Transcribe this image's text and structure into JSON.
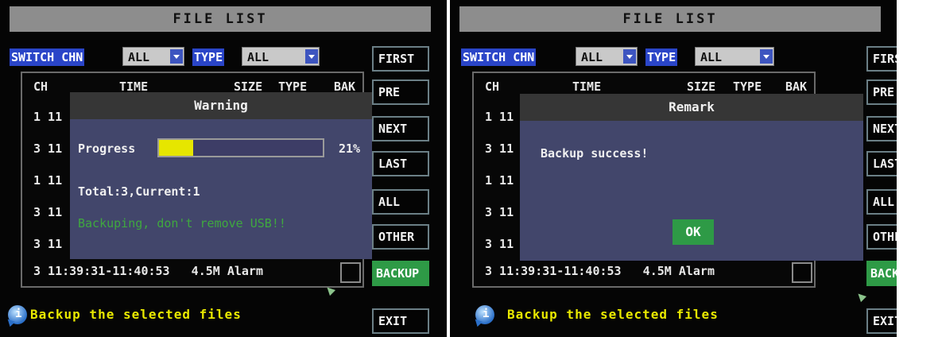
{
  "screens": [
    {
      "title": "FILE LIST",
      "switch_chn_label": "SWITCH CHN",
      "channel_value": "ALL",
      "type_label": "TYPE",
      "type_value": "ALL",
      "columns": [
        "CH",
        "TIME",
        "SIZE",
        "TYPE",
        "BAK"
      ],
      "rows": [
        "1 11",
        "3 11",
        "1 11",
        "3 11",
        "3 11",
        "3 11:39:31-11:40:53   4.5M Alarm"
      ],
      "buttons": [
        "FIRST",
        "PRE",
        "NEXT",
        "LAST",
        "ALL",
        "OTHER",
        "BACKUP",
        "EXIT"
      ],
      "hint": "Backup the selected files",
      "dialog": {
        "title": "Warning",
        "progress_label": "Progress",
        "progress_percent": "21%",
        "progress_value": 0.21,
        "total_line": "Total:3,Current:1",
        "warning_line": "Backuping, don't remove USB!!"
      }
    },
    {
      "title": "FILE LIST",
      "switch_chn_label": "SWITCH CHN",
      "channel_value": "ALL",
      "type_label": "TYPE",
      "type_value": "ALL",
      "columns": [
        "CH",
        "TIME",
        "SIZE",
        "TYPE",
        "BAK"
      ],
      "rows": [
        "1 11",
        "3 11",
        "1 11",
        "3 11",
        "3 11",
        "3 11:39:31-11:40:53   4.5M Alarm"
      ],
      "buttons": [
        "FIRST",
        "PRE",
        "NEXT",
        "LAST",
        "ALL",
        "OTHER",
        "BACKUP",
        "EXIT"
      ],
      "hint": "Backup the selected files",
      "dialog": {
        "title": "Remark",
        "message": "Backup success!",
        "ok_label": "OK"
      }
    }
  ],
  "colors": {
    "title_bar": "#8d8d8d",
    "label_blue": "#2a45c8",
    "selected_button": "#2e9a46",
    "dialog_bg": "#42466b",
    "progress_fill": "#e6e600",
    "hint_text": "#e8e800",
    "warning_text": "#3fa83f"
  },
  "icons": [
    "info-bubble-icon",
    "mouse-cursor-icon",
    "dropdown-arrow-icon"
  ]
}
